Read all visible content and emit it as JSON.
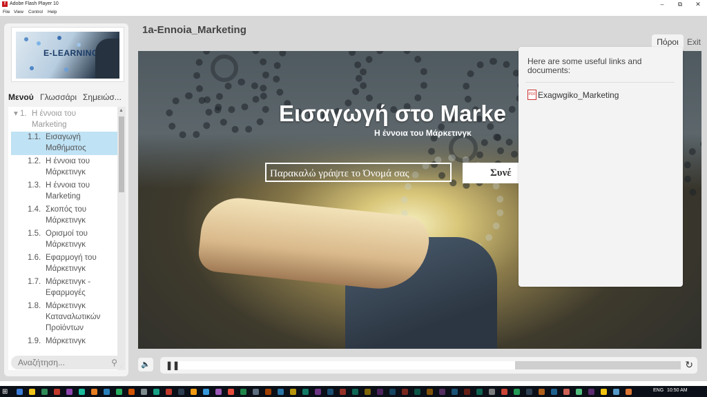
{
  "window": {
    "title": "Adobe Flash Player 10",
    "menu": [
      "File",
      "View",
      "Control",
      "Help"
    ],
    "controls": {
      "minimize": "‒",
      "restore": "⧉",
      "close": "✕"
    }
  },
  "sidebar": {
    "logo_text": "E-LEARNING",
    "tabs": [
      "Μενού",
      "Γλωσσάρι",
      "Σημειώσ..."
    ],
    "active_tab": "Μενού",
    "tree_root": {
      "prefix": "▾ 1.",
      "label": "Η έννοια του Marketing"
    },
    "items": [
      {
        "num": "1.1.",
        "label": "Εισαγωγή Μαθήματος",
        "selected": true
      },
      {
        "num": "1.2.",
        "label": "Η έννοια του Μάρκετινγκ",
        "selected": false
      },
      {
        "num": "1.3.",
        "label": "Η έννοια του Marketing",
        "selected": false
      },
      {
        "num": "1.4.",
        "label": "Σκοπός του Μάρκετινγκ",
        "selected": false
      },
      {
        "num": "1.5.",
        "label": "Ορισμοί του Μάρκετινγκ",
        "selected": false
      },
      {
        "num": "1.6.",
        "label": "Εφαρμογή του Μάρκετινγκ",
        "selected": false
      },
      {
        "num": "1.7.",
        "label": "Μάρκετινγκ - Εφαρμογές",
        "selected": false
      },
      {
        "num": "1.8.",
        "label": "Μάρκετινγκ Καταναλωτικών Προϊόντων",
        "selected": false
      },
      {
        "num": "1.9.",
        "label": "Μάρκετινγκ",
        "selected": false
      }
    ],
    "search_placeholder": "Αναζήτηση..."
  },
  "course": {
    "title": "1a-Ennoia_Marketing"
  },
  "slide": {
    "title": "Εισαγωγή στο Marke",
    "subtitle": "Η έννοια του Μάρκετινγκ",
    "name_placeholder": "Παρακαλώ γράψτε το Όνομά σας",
    "continue_label": "Συνέ"
  },
  "tabs_right": {
    "resources": "Πόροι",
    "exit": "Exit"
  },
  "resources": {
    "intro": "Here are some useful links and documents:",
    "link": "Exagwgiko_Marketing",
    "link_icon": "pdf-icon"
  },
  "playback": {
    "state": "playing",
    "progress": 0.67
  },
  "taskbar": {
    "lang": "ENG",
    "time": "10:50 AM"
  }
}
